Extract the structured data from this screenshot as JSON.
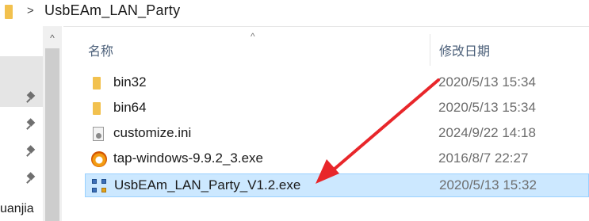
{
  "address_bar": {
    "folder_icon": "folder-icon",
    "chevron": ">",
    "path_segment": "UsbEAm_LAN_Party"
  },
  "nav_pane": {
    "partial_item_text": "uanjia",
    "scroll_up_glyph": "^",
    "pin_icon": "pin-icon"
  },
  "file_list": {
    "sort_indicator": "^",
    "columns": {
      "name": "名称",
      "date_modified": "修改日期"
    },
    "rows": [
      {
        "name": "bin32",
        "date": "2020/5/13 15:34",
        "icon": "folder-icon",
        "selected": false
      },
      {
        "name": "bin64",
        "date": "2020/5/13 15:34",
        "icon": "folder-icon",
        "selected": false
      },
      {
        "name": "customize.ini",
        "date": "2024/9/22 14:18",
        "icon": "settings-file-icon",
        "selected": false
      },
      {
        "name": "tap-windows-9.9.2_3.exe",
        "date": "2016/8/7 22:27",
        "icon": "installer-icon",
        "selected": false
      },
      {
        "name": "UsbEAm_LAN_Party_V1.2.exe",
        "date": "2020/5/13 15:32",
        "icon": "network-app-icon",
        "selected": true
      }
    ]
  },
  "colors": {
    "selection_bg": "#cce8ff",
    "selection_border": "#99d1ff",
    "annotation_arrow": "#e8262a",
    "header_text": "#4c607a"
  }
}
